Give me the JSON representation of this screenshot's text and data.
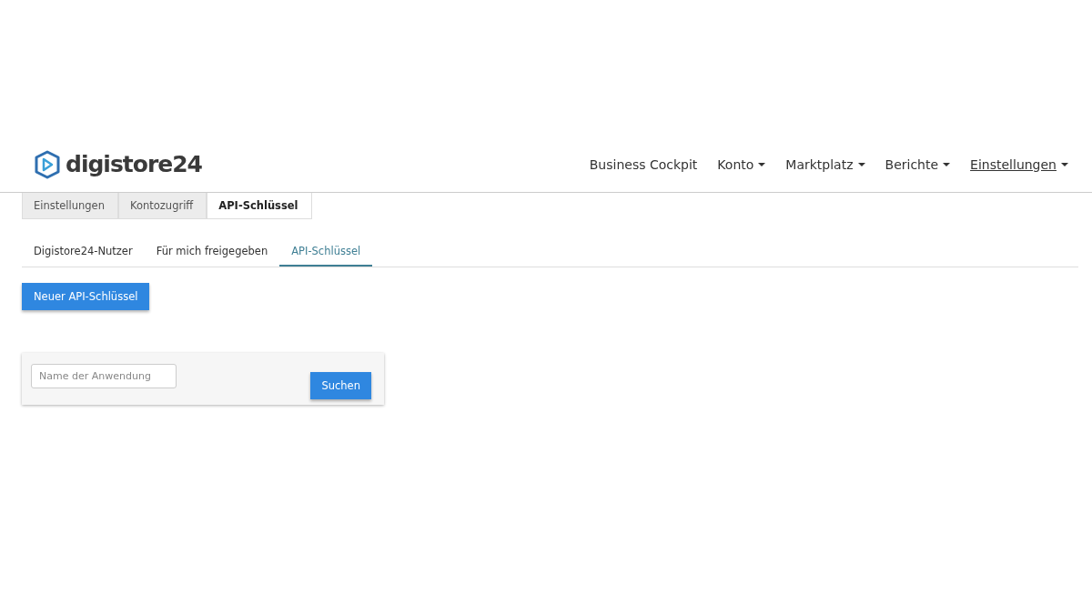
{
  "logo": {
    "text": "digistore24"
  },
  "nav": [
    {
      "label": "Business Cockpit",
      "dropdown": false,
      "selected": false
    },
    {
      "label": "Konto",
      "dropdown": true,
      "selected": false
    },
    {
      "label": "Marktplatz",
      "dropdown": true,
      "selected": false
    },
    {
      "label": "Berichte",
      "dropdown": true,
      "selected": false
    },
    {
      "label": "Einstellungen",
      "dropdown": true,
      "selected": true
    }
  ],
  "breadcrumb": [
    {
      "label": "Einstellungen",
      "selected": false
    },
    {
      "label": "Kontozugriff",
      "selected": false
    },
    {
      "label": "API-Schlüssel",
      "selected": true
    }
  ],
  "tabs": [
    {
      "label": "Digistore24-Nutzer",
      "selected": false
    },
    {
      "label": "Für mich freigegeben",
      "selected": false
    },
    {
      "label": "API-Schlüssel",
      "selected": true
    }
  ],
  "new_button": "Neuer API-Schlüssel",
  "search": {
    "placeholder": "Name der Anwendung",
    "button": "Suchen"
  }
}
